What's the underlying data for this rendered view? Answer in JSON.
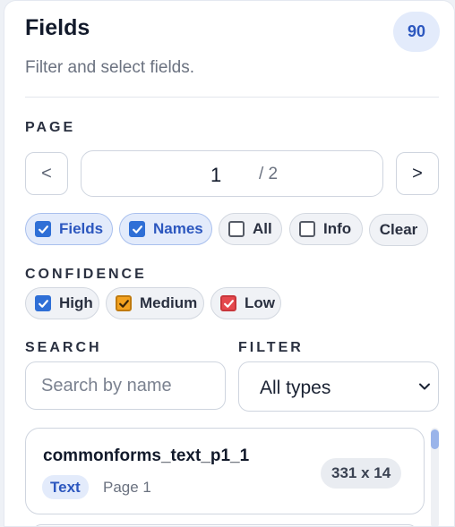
{
  "panel": {
    "title": "Fields",
    "count": "90",
    "subtitle": "Filter and select fields."
  },
  "page": {
    "label": "PAGE",
    "prev_label": "<",
    "next_label": ">",
    "current": "1",
    "total": "/ 2"
  },
  "view_chips": [
    {
      "label": "Fields",
      "checked": true
    },
    {
      "label": "Names",
      "checked": true
    },
    {
      "label": "All",
      "checked": false
    },
    {
      "label": "Info",
      "checked": false
    }
  ],
  "clear_label": "Clear",
  "confidence": {
    "label": "CONFIDENCE",
    "levels": [
      {
        "label": "High",
        "checked": true,
        "color": "#2f6fd6"
      },
      {
        "label": "Medium",
        "checked": true,
        "color": "#f2a11f"
      },
      {
        "label": "Low",
        "checked": true,
        "color": "#e5484d"
      }
    ]
  },
  "search": {
    "label": "SEARCH",
    "placeholder": "Search by name",
    "value": ""
  },
  "filter": {
    "label": "FILTER",
    "selected": "All types"
  },
  "fields": [
    {
      "name": "commonforms_text_p1_1",
      "type": "Text",
      "page": "Page 1",
      "size": "331 x 14"
    }
  ],
  "colors": {
    "accent": "#2c57bf",
    "accent_bg": "#e3ebfb"
  }
}
